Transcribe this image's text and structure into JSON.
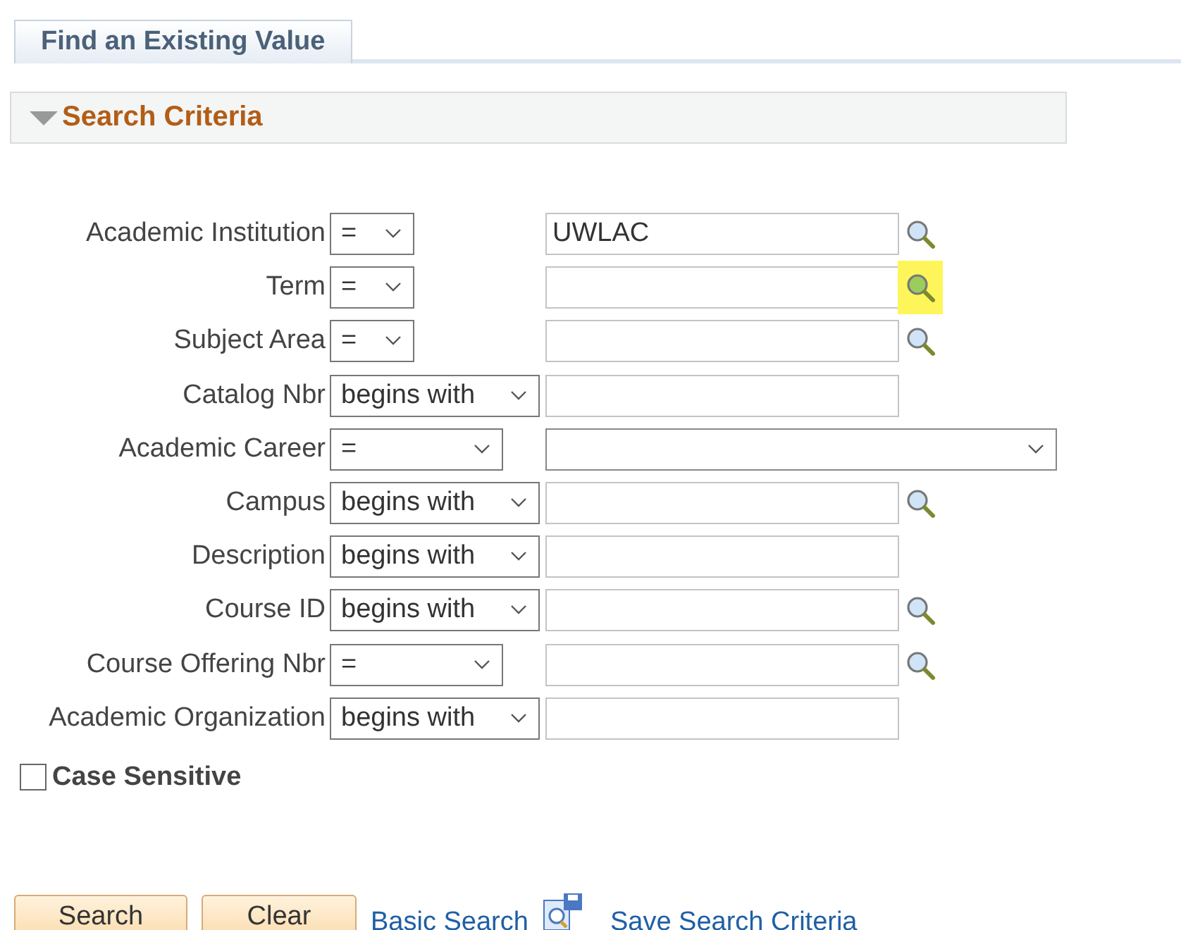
{
  "tabs": [
    {
      "label": "Find an Existing Value",
      "selected": true
    }
  ],
  "section": {
    "title": "Search Criteria",
    "expanded": true
  },
  "fields": [
    {
      "label": "Academic Institution",
      "operator": {
        "text": "=",
        "kind": "narrow"
      },
      "kind": "lookup",
      "value": "UWLAC",
      "highlighted": false
    },
    {
      "label": "Term",
      "operator": {
        "text": "=",
        "kind": "narrow"
      },
      "kind": "lookup",
      "highlighted": true
    },
    {
      "label": "Subject Area",
      "operator": {
        "text": "=",
        "kind": "narrow"
      },
      "kind": "lookup",
      "highlighted": false
    },
    {
      "label": "Catalog Nbr",
      "operator": {
        "text": "begins with",
        "kind": "wide"
      },
      "kind": "input"
    },
    {
      "label": "Academic Career",
      "operator": {
        "text": "=",
        "kind": "medium"
      },
      "kind": "dropdown"
    },
    {
      "label": "Campus",
      "operator": {
        "text": "begins with",
        "kind": "wide"
      },
      "kind": "lookup",
      "highlighted": false
    },
    {
      "label": "Description",
      "operator": {
        "text": "begins with",
        "kind": "wide"
      },
      "kind": "input"
    },
    {
      "label": "Course ID",
      "operator": {
        "text": "begins with",
        "kind": "wide"
      },
      "kind": "lookup",
      "highlighted": false
    },
    {
      "label": "Course Offering Nbr",
      "operator": {
        "text": "=",
        "kind": "medium"
      },
      "kind": "lookup",
      "highlighted": false
    },
    {
      "label": "Academic Organization",
      "operator": {
        "text": "begins with",
        "kind": "wide"
      },
      "kind": "input"
    }
  ],
  "case_sensitive": {
    "label": "Case Sensitive",
    "checked": false
  },
  "buttons": [
    "Search",
    "Clear"
  ],
  "links": [
    {
      "label": "Basic Search",
      "kind": "link"
    },
    {
      "label": "Save Search Criteria",
      "kind": "save"
    }
  ]
}
